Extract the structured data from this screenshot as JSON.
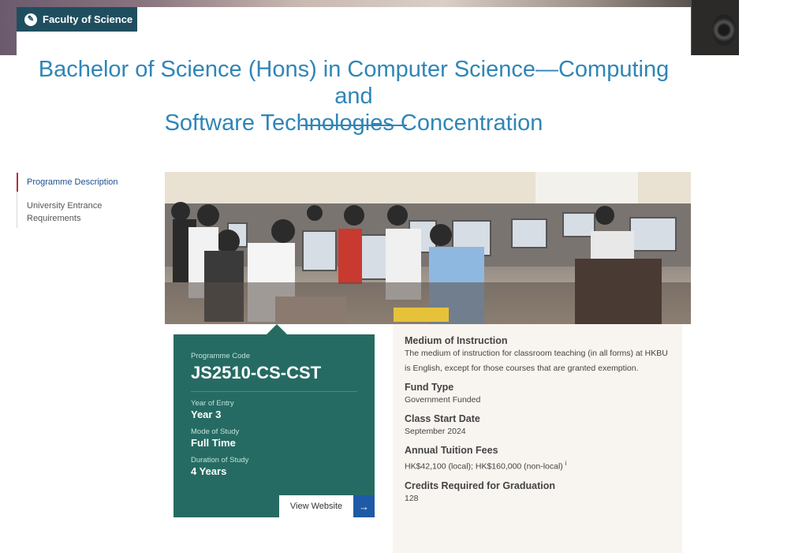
{
  "faculty": {
    "label": "Faculty of Science",
    "icon": "leaf-icon"
  },
  "page": {
    "title_line1": "Bachelor of Science (Hons) in Computer Science—Computing and",
    "title_line2": "Software Technologies Concentration"
  },
  "side_nav": {
    "items": [
      {
        "label": "Programme Description",
        "active": true
      },
      {
        "label": "University Entrance Requirements",
        "active": false
      }
    ]
  },
  "programme": {
    "code_label": "Programme Code",
    "code": "JS2510-CS-CST",
    "year_label": "Year of Entry",
    "year": "Year 3",
    "mode_label": "Mode of Study",
    "mode": "Full Time",
    "duration_label": "Duration of Study",
    "duration": "4 Years",
    "website_label": "View Website",
    "arrow_icon": "arrow-right-icon"
  },
  "info": {
    "medium_heading": "Medium of Instruction",
    "medium_text": "The medium of instruction for classroom teaching (in all forms) at HKBU is English, except for those courses that are granted exemption.",
    "fund_heading": "Fund Type",
    "fund_text": "Government Funded",
    "start_heading": "Class Start Date",
    "start_text": "September 2024",
    "fees_heading": "Annual Tuition Fees",
    "fees_text": "HK$42,100 (local); HK$160,000 (non-local)",
    "fees_note": "i",
    "credits_heading": "Credits Required for Graduation",
    "credits_text": "128"
  },
  "colors": {
    "title_blue": "#2f86b6",
    "faculty_tag": "#1f4e5f",
    "code_card": "#266b63",
    "arrow_button": "#1f5aa6",
    "info_panel": "#f8f4ef"
  }
}
